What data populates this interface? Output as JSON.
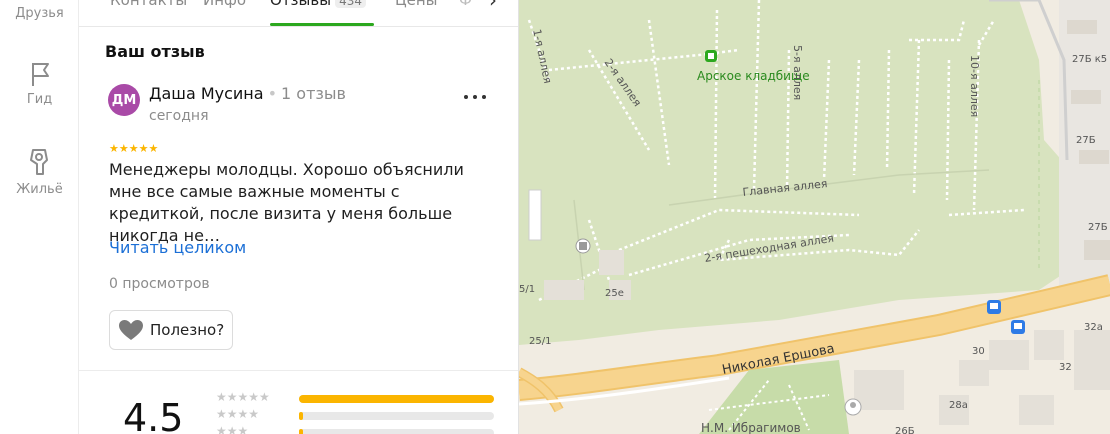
{
  "rail": {
    "friends": "Друзья",
    "guide": "Гид",
    "housing": "Жильё"
  },
  "tabs": {
    "contacts": "Контакты",
    "info": "Инфо",
    "reviews": "Отзывы",
    "reviews_count": "434",
    "prices": "Цены",
    "more": "Ф"
  },
  "review": {
    "section_title": "Ваш отзыв",
    "initials": "ДМ",
    "author": "Даша Мусина",
    "author_reviews": "1 отзыв",
    "date": "сегодня",
    "stars": 5,
    "text": "Менеджеры молодцы. Хорошо объяснили мне все самые важные моменты с кредиткой, после визита у меня больше никогда не…",
    "read_more": "Читать целиком",
    "views": "0 просмотров",
    "useful": "Полезно?"
  },
  "rating": {
    "value": "4.5",
    "distribution": [
      {
        "stars": 5,
        "fraction": 1.0
      },
      {
        "stars": 4,
        "fraction": 0.02
      },
      {
        "stars": 3,
        "fraction": 0.02
      }
    ]
  },
  "map": {
    "cemetery": "Арское кладбище",
    "alley1": "1-я аллея",
    "alley2": "2-я аллея",
    "alley5": "5-я аллея",
    "alley10": "10-я аллея",
    "main_alley": "Главная аллея",
    "ped_alley": "2-я пешеходная аллея",
    "street": "Николая Ершова",
    "street2": "Н.М. Ибрагимов",
    "h27b5": "27Б к5",
    "h27b": "27Б",
    "h27b_2": "27Б",
    "h25e": "25е",
    "h25_1a": "25/1",
    "h25_1b": "5/1",
    "h30": "30",
    "h32a": "32а",
    "h32": "32",
    "h28a": "28а",
    "h26b": "26Б"
  },
  "colors": {
    "accent_green": "#2ca81e",
    "link_blue": "#1b6fd6",
    "star_yellow": "#fbb500",
    "avatar": "#a94aa7",
    "park_green": "#d9e4c1",
    "road_orange": "#f7d48e"
  }
}
